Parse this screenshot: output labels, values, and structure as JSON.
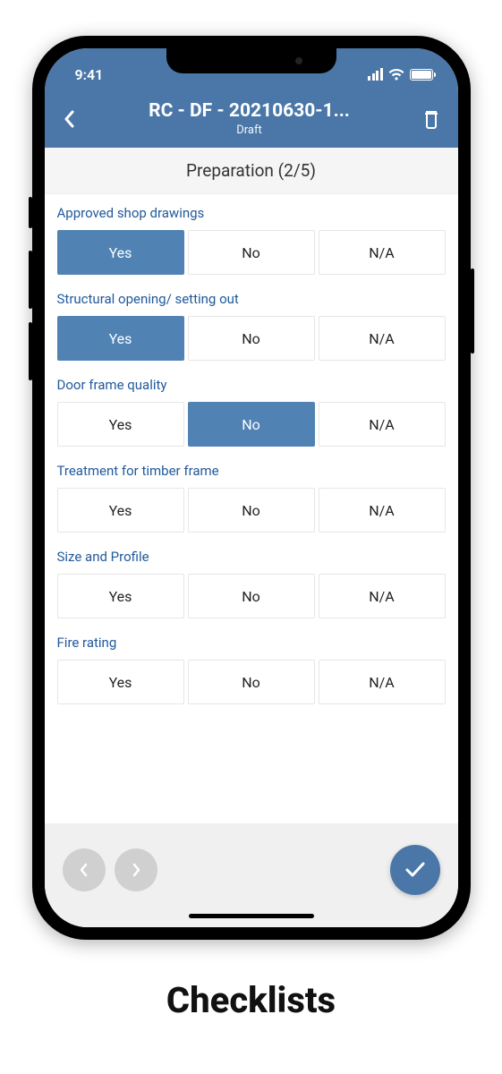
{
  "statusbar": {
    "time": "9:41"
  },
  "header": {
    "title": "RC - DF - 20210630-1...",
    "subtitle": "Draft"
  },
  "section": {
    "title": "Preparation (2/5)"
  },
  "options": {
    "yes": "Yes",
    "no": "No",
    "na": "N/A"
  },
  "questions": [
    {
      "label": "Approved shop drawings",
      "selected": "yes"
    },
    {
      "label": "Structural opening/ setting out",
      "selected": "yes"
    },
    {
      "label": "Door frame quality",
      "selected": "no"
    },
    {
      "label": "Treatment for timber frame",
      "selected": null
    },
    {
      "label": "Size and Profile",
      "selected": null
    },
    {
      "label": "Fire rating",
      "selected": null
    }
  ],
  "caption": "Checklists"
}
